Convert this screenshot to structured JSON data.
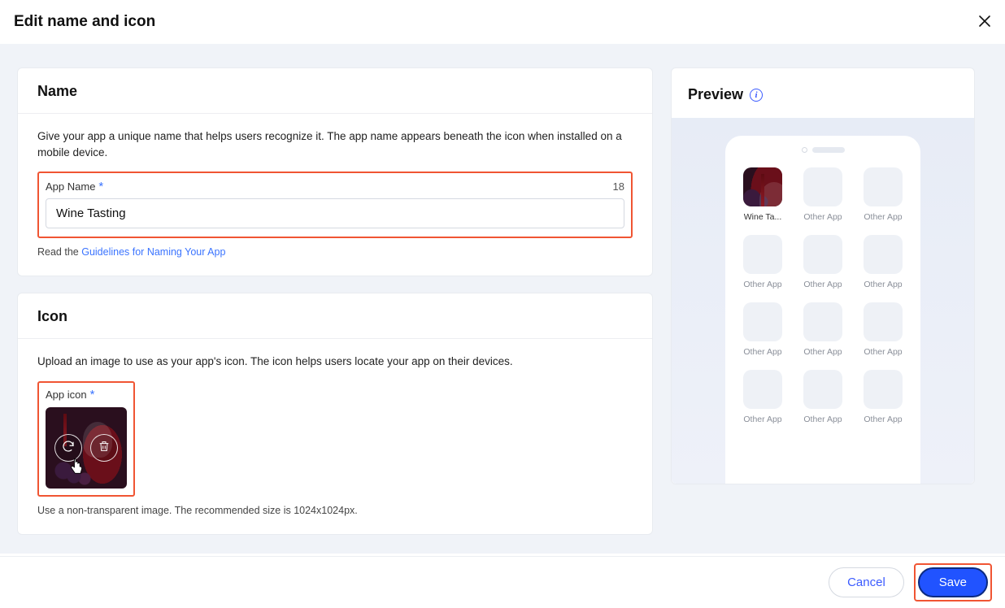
{
  "header": {
    "title": "Edit name and icon"
  },
  "name_section": {
    "heading": "Name",
    "description": "Give your app a unique name that helps users recognize it. The app name appears beneath the icon when installed on a mobile device.",
    "field_label": "App Name",
    "char_count": "18",
    "value": "Wine Tasting",
    "hint_prefix": "Read the ",
    "hint_link": "Guidelines for Naming Your App"
  },
  "icon_section": {
    "heading": "Icon",
    "description": "Upload an image to use as your app's icon. The icon helps users locate your app on their devices.",
    "field_label": "App icon",
    "hint": "Use a non-transparent image. The recommended size is 1024x1024px."
  },
  "preview": {
    "heading": "Preview",
    "first_app_label": "Wine Ta...",
    "other_label": "Other App"
  },
  "footer": {
    "cancel": "Cancel",
    "save": "Save"
  }
}
